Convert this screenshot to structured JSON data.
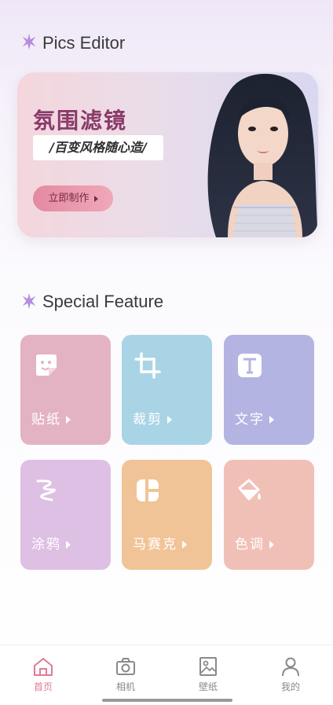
{
  "header": {
    "title": "Pics Editor"
  },
  "banner": {
    "title": "氛围滤镜",
    "subtitle": "/百变风格随心造/",
    "button_label": "立即制作"
  },
  "features": {
    "title": "Special Feature",
    "items": [
      {
        "label": "贴纸",
        "icon": "sticker-icon",
        "color": "#e4b3c3"
      },
      {
        "label": "裁剪",
        "icon": "crop-icon",
        "color": "#a9d4e6"
      },
      {
        "label": "文字",
        "icon": "text-icon",
        "color": "#b4b4e3"
      },
      {
        "label": "涂鸦",
        "icon": "doodle-icon",
        "color": "#ddc0e3"
      },
      {
        "label": "马赛克",
        "icon": "mosaic-icon",
        "color": "#f0c497"
      },
      {
        "label": "色调",
        "icon": "paint-bucket-icon",
        "color": "#f0c0b7"
      }
    ]
  },
  "tabbar": {
    "items": [
      {
        "label": "首页",
        "icon": "home-icon",
        "active": true
      },
      {
        "label": "相机",
        "icon": "camera-icon",
        "active": false
      },
      {
        "label": "壁纸",
        "icon": "image-icon",
        "active": false
      },
      {
        "label": "我的",
        "icon": "user-icon",
        "active": false
      }
    ],
    "active_color": "#e07a95"
  }
}
